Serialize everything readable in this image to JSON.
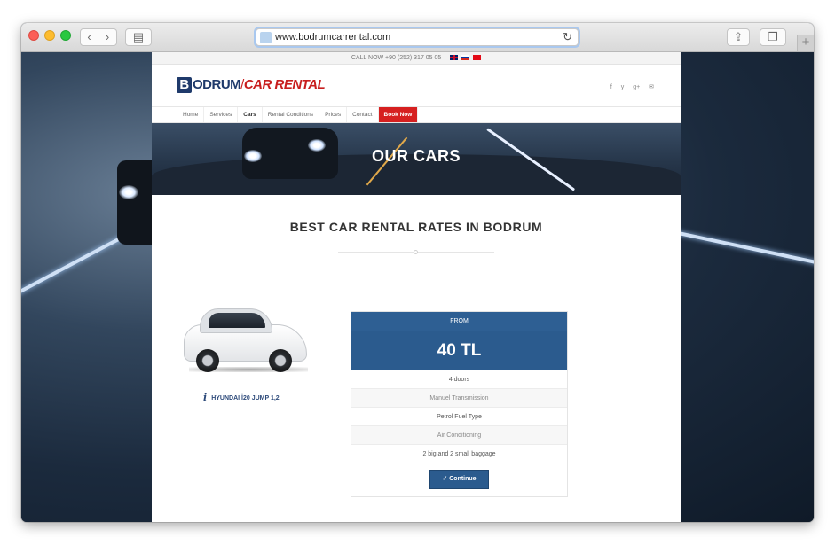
{
  "browser": {
    "url": "www.bodrumcarrental.com",
    "back_icon": "chevron-left-icon",
    "forward_icon": "chevron-right-icon"
  },
  "site": {
    "topbar": {
      "call_text": "CALL NOW +90 (252) 317 05 05"
    },
    "logo": {
      "initial": "B",
      "main": "ODRUM",
      "separator": "/",
      "sub": "CAR RENTAL"
    },
    "socials": [
      "f",
      "y",
      "g+",
      "✉"
    ],
    "menu": [
      {
        "label": "Home"
      },
      {
        "label": "Services"
      },
      {
        "label": "Cars"
      },
      {
        "label": "Rental Conditions"
      },
      {
        "label": "Prices"
      },
      {
        "label": "Contact"
      },
      {
        "label": "Book Now"
      }
    ],
    "hero_title": "OUR CARS",
    "section_title": "BEST CAR RENTAL RATES IN BODRUM",
    "car": {
      "name": "HYUNDAI İ20 JUMP 1,2"
    },
    "price_box": {
      "from_label": "FROM",
      "price": "40 TL",
      "features": [
        "4 doors",
        "Manuel Transmission",
        "Petrol Fuel Type",
        "Air Conditioning",
        "2 big and 2 small baggage"
      ],
      "button": "✓ Continue"
    },
    "colors": {
      "brand_blue": "#2b5b8e",
      "accent_red": "#d62020"
    }
  }
}
